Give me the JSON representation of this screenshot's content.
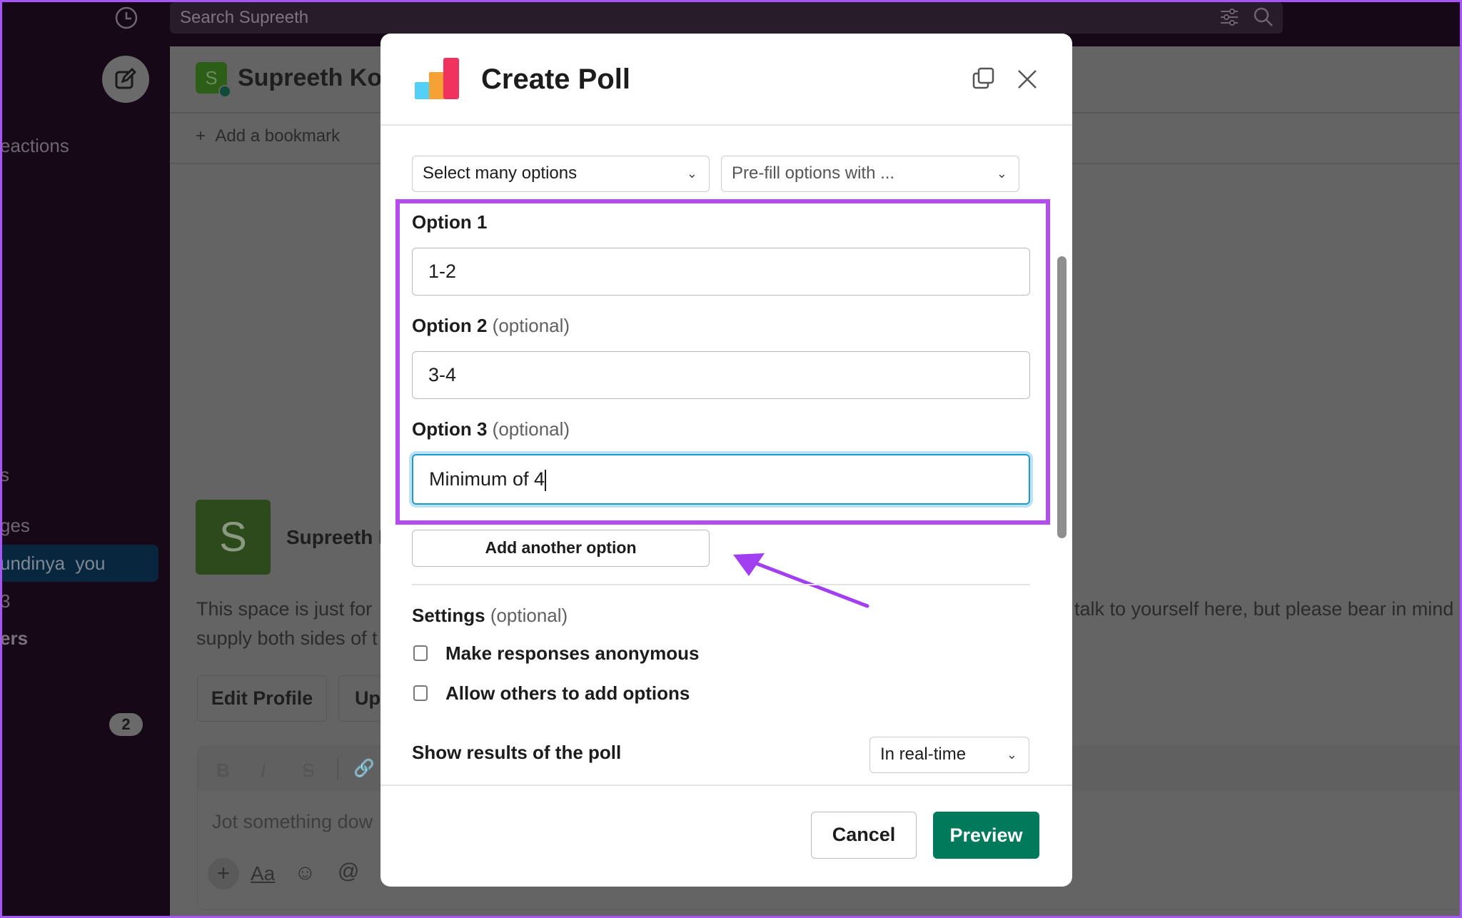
{
  "app": {
    "search_placeholder": "Search Supreeth",
    "icons": [
      "clock-icon",
      "filter-icon",
      "search-icon",
      "compose-icon"
    ]
  },
  "sidebar": {
    "items": [
      {
        "label": "eactions"
      },
      {
        "label": "s"
      },
      {
        "label": "ges"
      },
      {
        "label": "undinya",
        "suffix": "you"
      },
      {
        "label": "3"
      },
      {
        "label": "ers"
      }
    ],
    "badge": "2"
  },
  "channel": {
    "title": "Supreeth Kou",
    "avatar_letter": "S",
    "bookmark": "Add a bookmark",
    "profile_name": "Supreeth K",
    "intro_line1": "This space is just for",
    "intro_line2": "supply both sides of t",
    "intro_right": "talk to yourself here, but please bear in mind",
    "edit_profile": "Edit Profile",
    "upload": "Up",
    "composer_placeholder": "Jot something dow",
    "format_bold": "B",
    "format_italic": "I",
    "format_strike": "S",
    "text_format": "Aa",
    "mention": "@"
  },
  "modal": {
    "title": "Create Poll",
    "type_select": "Select many options",
    "prefill_select": "Pre-fill options with ...",
    "options": [
      {
        "label": "Option 1",
        "optional": "",
        "value": "1-2"
      },
      {
        "label": "Option 2",
        "optional": "(optional)",
        "value": "3-4"
      },
      {
        "label": "Option 3",
        "optional": "(optional)",
        "value": "Minimum of 4"
      }
    ],
    "add_option": "Add another option",
    "settings_label": "Settings",
    "settings_optional": "(optional)",
    "checkboxes": [
      {
        "label": "Make responses anonymous",
        "checked": false
      },
      {
        "label": "Allow others to add options",
        "checked": false
      }
    ],
    "results_label": "Show results of the poll",
    "results_value": "In real-time",
    "cancel": "Cancel",
    "preview": "Preview"
  },
  "colors": {
    "highlight": "#b44cf0",
    "primary": "#007a5a",
    "focus": "#1d9bd1"
  }
}
